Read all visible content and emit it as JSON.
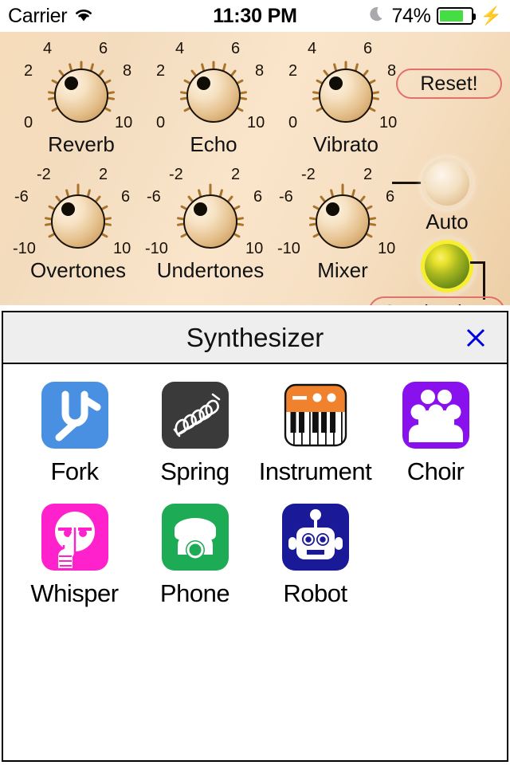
{
  "status_bar": {
    "carrier": "Carrier",
    "wifi_icon": "wifi-icon",
    "time": "11:30 PM",
    "moon_icon": "moon-icon",
    "battery_percent": "74%",
    "battery_color": "#44DD44",
    "charging_icon": "lightning-bolt-icon"
  },
  "panel": {
    "background_color": "#f5ddbe",
    "reset_label": "Reset!",
    "reset_border_color": "#e2706b",
    "synthesizer_label": "Synthesizer",
    "auto_label": "Auto",
    "led_color": "#9fc02a",
    "knobs": [
      {
        "label": "Reverb",
        "ticks": [
          "0",
          "2",
          "4",
          "6",
          "8",
          "10"
        ]
      },
      {
        "label": "Echo",
        "ticks": [
          "0",
          "2",
          "4",
          "6",
          "8",
          "10"
        ]
      },
      {
        "label": "Vibrato",
        "ticks": [
          "0",
          "2",
          "4",
          "6",
          "8",
          "10"
        ]
      },
      {
        "label": "Overtones",
        "ticks": [
          "-10",
          "-6",
          "-2",
          "2",
          "6",
          "10"
        ]
      },
      {
        "label": "Undertones",
        "ticks": [
          "-10",
          "-6",
          "-2",
          "2",
          "6",
          "10"
        ]
      },
      {
        "label": "Mixer",
        "ticks": [
          "-10",
          "-6",
          "-2",
          "2",
          "6",
          "10"
        ]
      }
    ]
  },
  "dialog": {
    "title": "Synthesizer",
    "close_icon": "close-x-icon",
    "close_color": "#0000dd",
    "items": [
      {
        "label": "Fork",
        "icon": "tuning-fork-icon",
        "color": "#4a90e2"
      },
      {
        "label": "Spring",
        "icon": "spring-coil-icon",
        "color": "#3a3a3a"
      },
      {
        "label": "Instrument",
        "icon": "keyboard-icon",
        "color": "#f0822e"
      },
      {
        "label": "Choir",
        "icon": "choir-people-icon",
        "color": "#8811ee"
      },
      {
        "label": "Whisper",
        "icon": "shush-face-icon",
        "color": "#ff22cc"
      },
      {
        "label": "Phone",
        "icon": "telephone-icon",
        "color": "#1dab55"
      },
      {
        "label": "Robot",
        "icon": "robot-head-icon",
        "color": "#1a1a99"
      }
    ]
  }
}
